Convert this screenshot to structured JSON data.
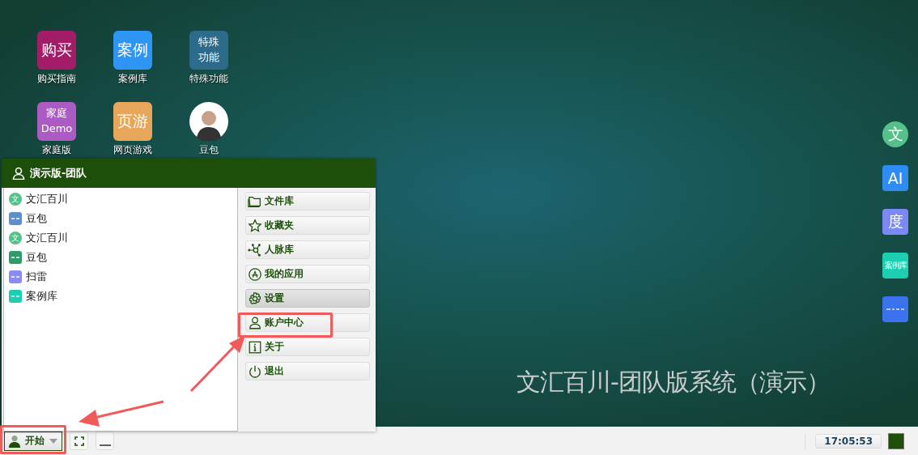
{
  "desktop_icons": [
    {
      "tile_text": "购买",
      "label": "购买指南",
      "color": "#a31c67",
      "kind": "tile"
    },
    {
      "tile_text": "案例",
      "label": "案例库",
      "color": "#2f95f5",
      "kind": "tile"
    },
    {
      "tile_lines": [
        "特殊",
        "功能"
      ],
      "label": "特殊功能",
      "color": "#2d6b8a",
      "kind": "tile-small"
    },
    {
      "tile_lines": [
        "家庭",
        "Demo"
      ],
      "label": "家庭版",
      "color": "#ad5bc4",
      "kind": "tile-small"
    },
    {
      "tile_text": "页游",
      "label": "网页游戏",
      "color": "#e8a65a",
      "kind": "tile"
    },
    {
      "label": "豆包",
      "kind": "avatar"
    }
  ],
  "dock_icons": [
    {
      "text": "文",
      "color": "#56c08a",
      "kind": "round"
    },
    {
      "text": "AI",
      "color": "#2f8cf5",
      "kind": "square"
    },
    {
      "text": "度",
      "color": "#7b88f5",
      "kind": "square"
    },
    {
      "text": "案例库",
      "color": "#1ccfb0",
      "kind": "small"
    },
    {
      "color": "#3b72ee",
      "kind": "blank"
    }
  ],
  "desktop_caption": "文汇百川-团队版系统（演示）",
  "start_menu": {
    "user": "演示版-团队",
    "recent": [
      {
        "label": "文汇百川",
        "color": "#56c08a",
        "kind": "round",
        "glyph": "文"
      },
      {
        "label": "豆包",
        "color": "#5d8fd0",
        "kind": "square"
      },
      {
        "label": "文汇百川",
        "color": "#56c08a",
        "kind": "round",
        "glyph": "文"
      },
      {
        "label": "豆包",
        "color": "#2f9a6a",
        "kind": "square"
      },
      {
        "label": "扫雷",
        "color": "#8a8cf5",
        "kind": "square"
      },
      {
        "label": "案例库",
        "color": "#1ccfb0",
        "kind": "square"
      }
    ],
    "actions": [
      {
        "label": "文件库",
        "selected": false
      },
      {
        "label": "收藏夹",
        "selected": false
      },
      {
        "label": "人脉库",
        "selected": false
      },
      {
        "label": "我的应用",
        "selected": false
      },
      {
        "label": "设置",
        "selected": true
      },
      {
        "label": "账户中心",
        "selected": false
      },
      {
        "label": "关于",
        "selected": false
      },
      {
        "label": "退出",
        "selected": false
      }
    ]
  },
  "taskbar": {
    "start_label": "开始",
    "clock": "17:05:53"
  }
}
